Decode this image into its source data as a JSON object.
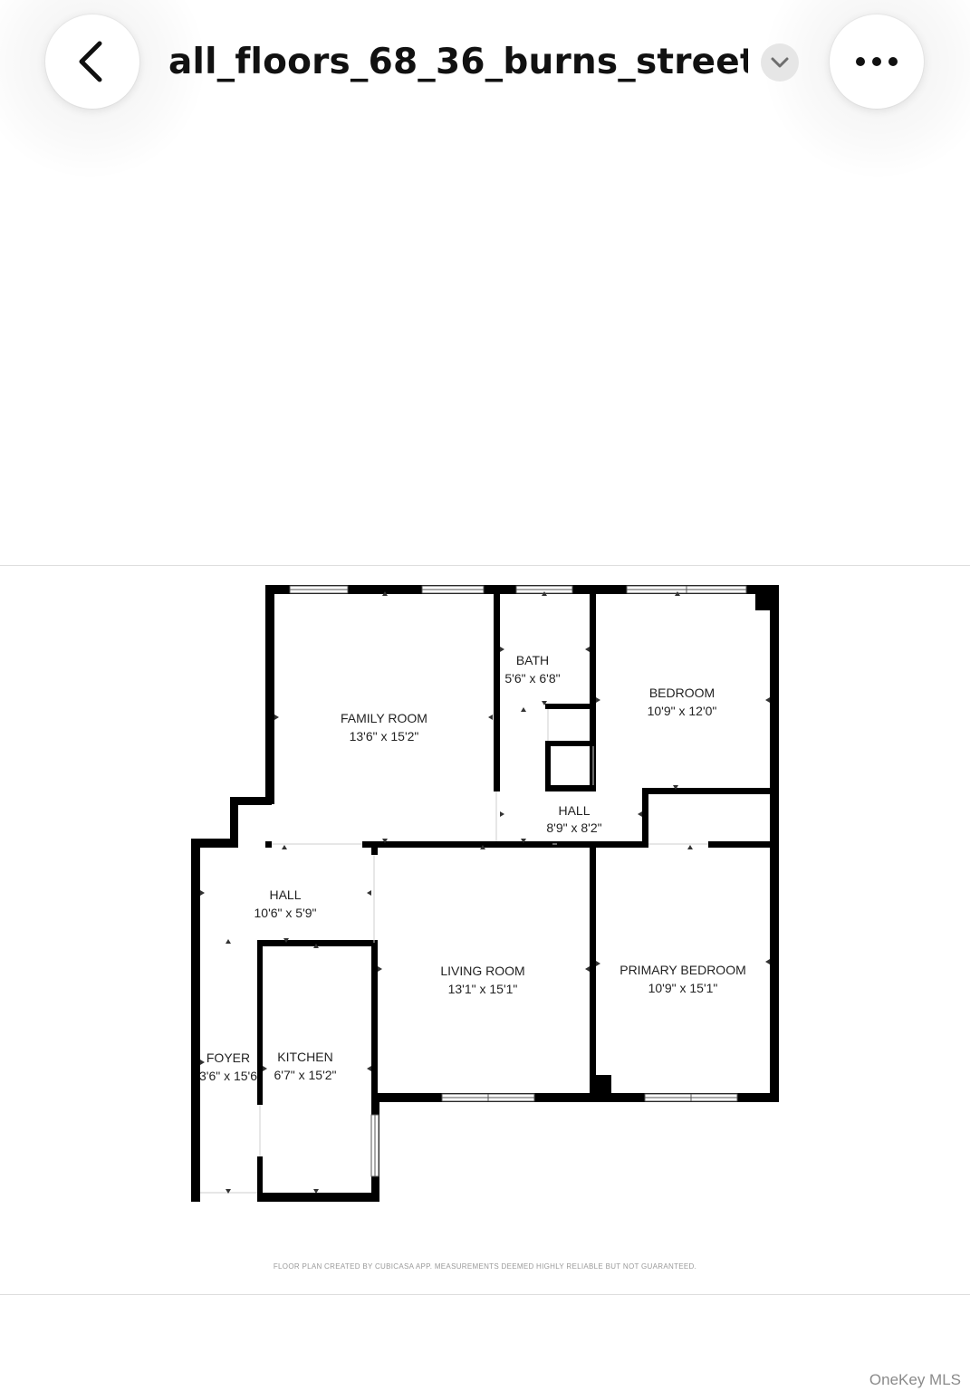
{
  "header": {
    "title": "all_floors_68_36_burns_street...",
    "back_icon": "chevron-left-icon",
    "dropdown_icon": "chevron-down-icon",
    "more_icon": "more-horizontal-icon"
  },
  "floorplan": {
    "rooms": [
      {
        "key": "family_room",
        "name": "FAMILY ROOM",
        "size": "13'6\" x 15'2\""
      },
      {
        "key": "bath",
        "name": "BATH",
        "size": "5'6\" x 6'8\""
      },
      {
        "key": "bedroom",
        "name": "BEDROOM",
        "size": "10'9\" x 12'0\""
      },
      {
        "key": "hall_center",
        "name": "HALL",
        "size": "8'9\" x 8'2\""
      },
      {
        "key": "hall_left",
        "name": "HALL",
        "size": "10'6\" x 5'9\""
      },
      {
        "key": "living_room",
        "name": "LIVING ROOM",
        "size": "13'1\" x 15'1\""
      },
      {
        "key": "primary_bedroom",
        "name": "PRIMARY BEDROOM",
        "size": "10'9\" x 15'1\""
      },
      {
        "key": "foyer",
        "name": "FOYER",
        "size": "3'6\" x 15'6"
      },
      {
        "key": "kitchen",
        "name": "KITCHEN",
        "size": "6'7\" x 15'2\""
      }
    ],
    "disclaimer": "FLOOR PLAN CREATED BY CUBICASA APP. MEASUREMENTS DEEMED HIGHLY RELIABLE BUT NOT GUARANTEED."
  },
  "watermark": "OneKey MLS"
}
